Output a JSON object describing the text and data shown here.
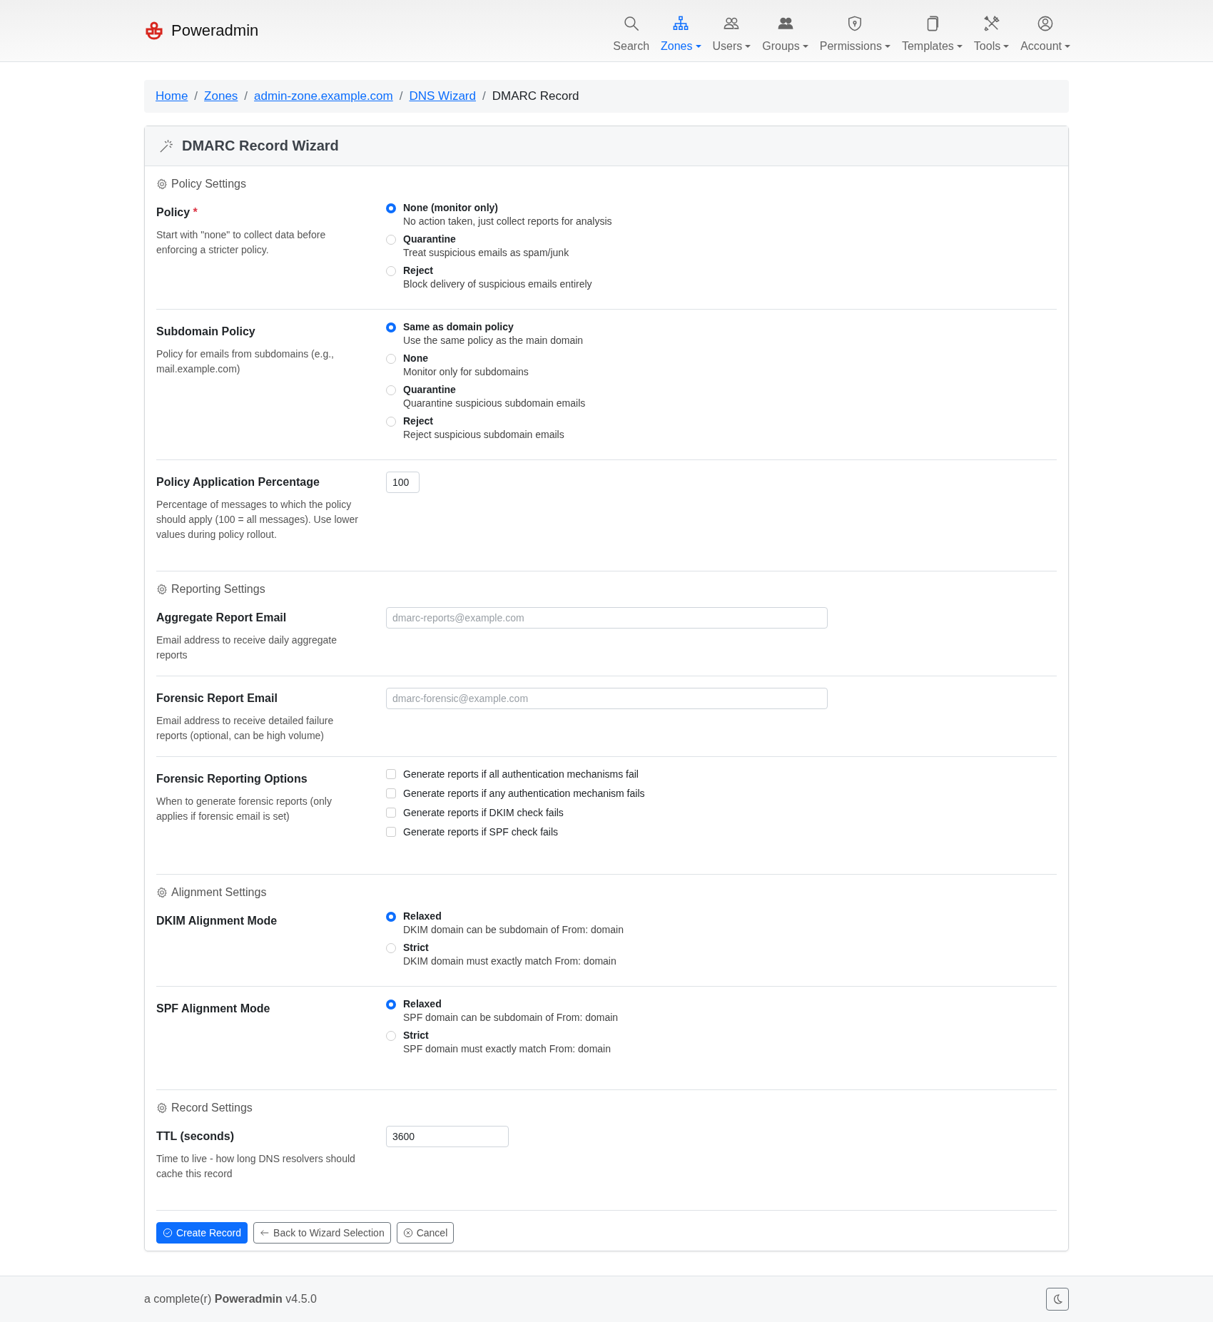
{
  "brand": "Poweradmin",
  "nav": [
    {
      "label": "Search",
      "selected": false,
      "dropdown": false
    },
    {
      "label": "Zones",
      "selected": true,
      "dropdown": true
    },
    {
      "label": "Users",
      "selected": false,
      "dropdown": true
    },
    {
      "label": "Groups",
      "selected": false,
      "dropdown": true
    },
    {
      "label": "Permissions",
      "selected": false,
      "dropdown": true
    },
    {
      "label": "Templates",
      "selected": false,
      "dropdown": true
    },
    {
      "label": "Tools",
      "selected": false,
      "dropdown": true
    },
    {
      "label": "Account",
      "selected": false,
      "dropdown": true
    }
  ],
  "breadcrumb": [
    {
      "label": "Home",
      "link": true
    },
    {
      "separator": "/",
      "label": "Zones",
      "link": true
    },
    {
      "separator": "/",
      "label": "admin-zone.example.com",
      "link": true
    },
    {
      "separator": "/",
      "label": "DNS Wizard",
      "link": true
    },
    {
      "separator": "/",
      "label": "DMARC Record",
      "link": false
    }
  ],
  "card": {
    "title": "DMARC Record Wizard"
  },
  "sections": [
    {
      "title": "Policy Settings",
      "fields": [
        {
          "kind": "radio",
          "label": "Policy",
          "required_mark": "*",
          "help": "Start with \"none\" to collect data before enforcing a stricter policy.",
          "options": [
            {
              "label": "None (monitor only)",
              "description": "No action taken, just collect reports for analysis",
              "selected": true
            },
            {
              "label": "Quarantine",
              "description": "Treat suspicious emails as spam/junk",
              "selected": false
            },
            {
              "label": "Reject",
              "description": "Block delivery of suspicious emails entirely",
              "selected": false
            }
          ]
        },
        {
          "kind": "radio",
          "label": "Subdomain Policy",
          "help": "Policy for emails from subdomains (e.g., mail.example.com)",
          "options": [
            {
              "label": "Same as domain policy",
              "description": "Use the same policy as the main domain",
              "selected": true
            },
            {
              "label": "None",
              "description": "Monitor only for subdomains",
              "selected": false
            },
            {
              "label": "Quarantine",
              "description": "Quarantine suspicious subdomain emails",
              "selected": false
            },
            {
              "label": "Reject",
              "description": "Reject suspicious subdomain emails",
              "selected": false
            }
          ]
        },
        {
          "kind": "percent",
          "label": "Policy Application Percentage",
          "help": "Percentage of messages to which the policy should apply (100 = all messages). Use lower values during policy rollout.",
          "value": "100"
        }
      ]
    },
    {
      "title": "Reporting Settings",
      "fields": [
        {
          "kind": "email",
          "label": "Aggregate Report Email",
          "help": "Email address to receive daily aggregate reports",
          "placeholder": "dmarc-reports@example.com"
        },
        {
          "kind": "email",
          "label": "Forensic Report Email",
          "help": "Email address to receive detailed failure reports (optional, can be high volume)",
          "placeholder": "dmarc-forensic@example.com"
        },
        {
          "kind": "checkbox",
          "label": "Forensic Reporting Options",
          "help": "When to generate forensic reports (only applies if forensic email is set)",
          "options": [
            {
              "label": "Generate reports if all authentication mechanisms fail",
              "checked": false
            },
            {
              "label": "Generate reports if any authentication mechanism fails",
              "checked": false
            },
            {
              "label": "Generate reports if DKIM check fails",
              "checked": false
            },
            {
              "label": "Generate reports if SPF check fails",
              "checked": false
            }
          ]
        }
      ]
    },
    {
      "title": "Alignment Settings",
      "fields": [
        {
          "kind": "radio",
          "label": "DKIM Alignment Mode",
          "options": [
            {
              "label": "Relaxed",
              "description": "DKIM domain can be subdomain of From: domain",
              "selected": true
            },
            {
              "label": "Strict",
              "description": "DKIM domain must exactly match From: domain",
              "selected": false
            }
          ]
        },
        {
          "kind": "radio",
          "label": "SPF Alignment Mode",
          "options": [
            {
              "label": "Relaxed",
              "description": "SPF domain can be subdomain of From: domain",
              "selected": true
            },
            {
              "label": "Strict",
              "description": "SPF domain must exactly match From: domain",
              "selected": false
            }
          ]
        }
      ]
    },
    {
      "title": "Record Settings",
      "fields": [
        {
          "kind": "number",
          "label": "TTL (seconds)",
          "help": "Time to live - how long DNS resolvers should cache this record",
          "value": "3600"
        }
      ]
    }
  ],
  "buttons": [
    {
      "label": "Create Record",
      "kind": "primary"
    },
    {
      "label": "Back to Wizard Selection",
      "kind": "back"
    },
    {
      "label": "Cancel",
      "kind": "cancel"
    }
  ],
  "footer": {
    "text": "a complete(r) **Poweradmin** v4.5.0"
  }
}
